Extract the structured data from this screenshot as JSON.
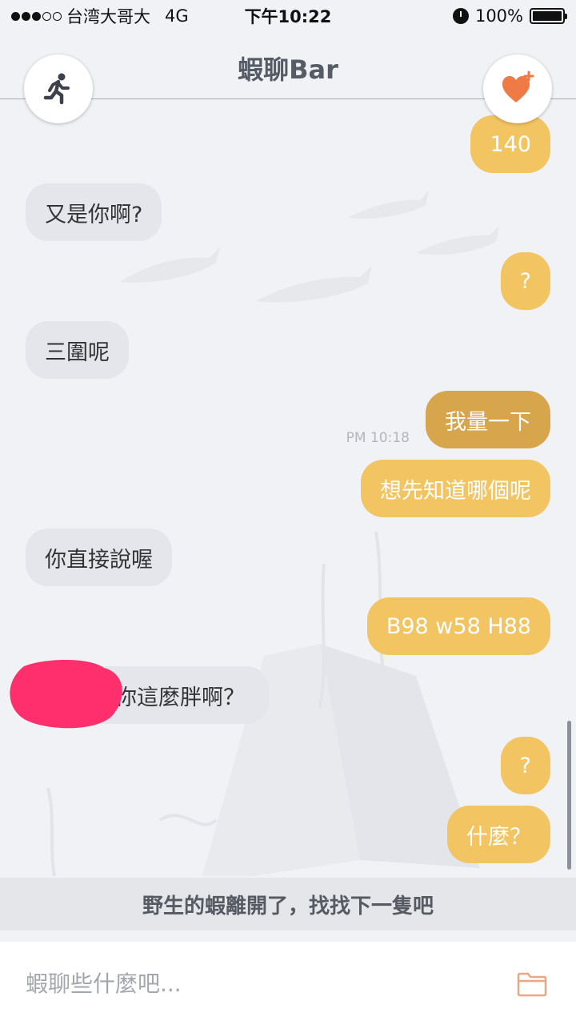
{
  "status_bar": {
    "carrier": "台湾大哥大",
    "network": "4G",
    "time": "下午10:22",
    "battery": "100%",
    "signal_bars_filled": 3,
    "signal_bars_total": 5
  },
  "header": {
    "title": "蝦聊Bar",
    "left_icon": "running-man-icon",
    "right_icon": "heart-plus-icon"
  },
  "messages": [
    {
      "side": "out",
      "text": "140"
    },
    {
      "side": "in",
      "text": "又是你啊?"
    },
    {
      "side": "out",
      "text": "?"
    },
    {
      "side": "in",
      "text": "三圍呢"
    },
    {
      "side": "out",
      "text": "我量一下",
      "time": "PM 10:18"
    },
    {
      "side": "out",
      "text": "想先知道哪個呢"
    },
    {
      "side": "in",
      "text": "你直接說喔"
    },
    {
      "side": "out",
      "text": "B98 w58 H88"
    },
    {
      "side": "in",
      "text": "你這麼胖啊？"
    },
    {
      "side": "out",
      "text": "?"
    },
    {
      "side": "out",
      "text": "什麼？"
    }
  ],
  "notice": "野生的蝦離開了，找找下一隻吧",
  "input": {
    "placeholder": "蝦聊些什麼吧...",
    "value": "",
    "attach_icon": "folder-icon"
  },
  "colors": {
    "background": "#f0f2f5",
    "incoming_bubble": "#e4e6ec",
    "outgoing_bubble": "#f3c462",
    "outgoing_bubble_selected": "#d7a54b",
    "heart": "#f07a45"
  }
}
